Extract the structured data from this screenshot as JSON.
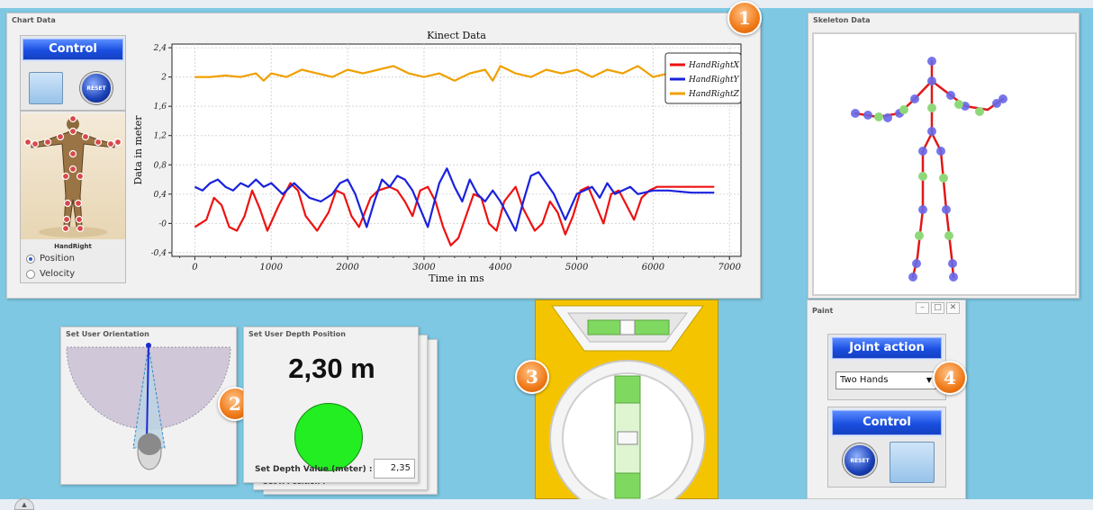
{
  "chart_panel": {
    "title": "Chart Data",
    "control_label": "Control",
    "reset_label": "RESET",
    "joint_label": "HandRight",
    "radio_position": "Position",
    "radio_velocity": "Velocity",
    "badge": "1"
  },
  "chart_data": {
    "type": "line",
    "title": "Kinect Data",
    "xlabel": "Time in ms",
    "ylabel": "Data in meter",
    "xlim": [
      -300,
      7150
    ],
    "ylim": [
      -0.45,
      2.45
    ],
    "x_ticks": [
      "0",
      "1000",
      "2000",
      "3000",
      "4000",
      "5000",
      "6000",
      "7000"
    ],
    "y_ticks": [
      "-0,4",
      "-0",
      "0,4",
      "0,8",
      "1,2",
      "1,6",
      "2",
      "2,4"
    ],
    "x_tick_values": [
      0,
      1000,
      2000,
      3000,
      4000,
      5000,
      6000,
      7000
    ],
    "y_tick_values": [
      -0.4,
      0,
      0.4,
      0.8,
      1.2,
      1.6,
      2.0,
      2.4
    ],
    "grid": true,
    "legend_position": "top-right",
    "series": [
      {
        "name": "HandRightX",
        "color": "#ee1111",
        "x": [
          0,
          150,
          250,
          350,
          450,
          550,
          650,
          750,
          850,
          950,
          1100,
          1250,
          1350,
          1450,
          1600,
          1750,
          1850,
          1950,
          2050,
          2150,
          2300,
          2400,
          2550,
          2650,
          2750,
          2850,
          2950,
          3050,
          3150,
          3250,
          3350,
          3450,
          3550,
          3650,
          3750,
          3850,
          3950,
          4050,
          4200,
          4300,
          4450,
          4550,
          4650,
          4750,
          4850,
          4950,
          5050,
          5150,
          5250,
          5350,
          5450,
          5550,
          5650,
          5750,
          5850,
          5950,
          6050,
          6200,
          6400,
          6600,
          6800
        ],
        "y": [
          -0.05,
          0.05,
          0.35,
          0.25,
          -0.05,
          -0.1,
          0.1,
          0.45,
          0.2,
          -0.1,
          0.25,
          0.55,
          0.45,
          0.1,
          -0.1,
          0.15,
          0.45,
          0.4,
          0.1,
          -0.05,
          0.35,
          0.45,
          0.5,
          0.45,
          0.3,
          0.1,
          0.45,
          0.5,
          0.3,
          -0.05,
          -0.3,
          -0.2,
          0.1,
          0.4,
          0.35,
          0.0,
          -0.1,
          0.3,
          0.5,
          0.2,
          -0.1,
          0.0,
          0.3,
          0.15,
          -0.15,
          0.1,
          0.45,
          0.5,
          0.25,
          0.0,
          0.4,
          0.45,
          0.25,
          0.05,
          0.35,
          0.45,
          0.5,
          0.5,
          0.5,
          0.5,
          0.5
        ]
      },
      {
        "name": "HandRightY",
        "color": "#1a22dd",
        "x": [
          0,
          100,
          200,
          300,
          400,
          500,
          600,
          700,
          800,
          900,
          1000,
          1150,
          1300,
          1400,
          1500,
          1650,
          1800,
          1900,
          2000,
          2100,
          2250,
          2350,
          2450,
          2550,
          2650,
          2750,
          2850,
          2950,
          3050,
          3200,
          3300,
          3400,
          3500,
          3600,
          3700,
          3800,
          3900,
          4000,
          4100,
          4200,
          4300,
          4400,
          4500,
          4600,
          4700,
          4850,
          5000,
          5100,
          5200,
          5300,
          5400,
          5500,
          5600,
          5700,
          5800,
          6000,
          6200,
          6500,
          6800
        ],
        "y": [
          0.5,
          0.45,
          0.55,
          0.6,
          0.5,
          0.45,
          0.55,
          0.5,
          0.6,
          0.5,
          0.55,
          0.4,
          0.55,
          0.45,
          0.35,
          0.3,
          0.4,
          0.55,
          0.6,
          0.4,
          -0.05,
          0.3,
          0.6,
          0.5,
          0.65,
          0.6,
          0.45,
          0.2,
          -0.05,
          0.55,
          0.75,
          0.5,
          0.3,
          0.6,
          0.4,
          0.3,
          0.45,
          0.3,
          0.1,
          -0.1,
          0.3,
          0.65,
          0.7,
          0.55,
          0.4,
          0.05,
          0.4,
          0.45,
          0.5,
          0.35,
          0.55,
          0.4,
          0.45,
          0.5,
          0.4,
          0.45,
          0.45,
          0.42,
          0.42
        ]
      },
      {
        "name": "HandRightZ",
        "color": "#f0a000",
        "x": [
          0,
          200,
          400,
          600,
          800,
          900,
          1000,
          1200,
          1400,
          1600,
          1800,
          2000,
          2200,
          2400,
          2600,
          2800,
          3000,
          3200,
          3400,
          3600,
          3800,
          3900,
          4000,
          4200,
          4400,
          4600,
          4800,
          5000,
          5200,
          5400,
          5600,
          5800,
          6000,
          6200,
          6400,
          6600,
          6800
        ],
        "y": [
          2.0,
          2.0,
          2.02,
          2.0,
          2.05,
          1.95,
          2.05,
          2.0,
          2.1,
          2.05,
          2.0,
          2.1,
          2.05,
          2.1,
          2.15,
          2.05,
          2.0,
          2.05,
          1.95,
          2.05,
          2.1,
          1.95,
          2.15,
          2.05,
          2.0,
          2.1,
          2.05,
          2.1,
          2.0,
          2.1,
          2.05,
          2.15,
          2.0,
          2.05,
          2.0,
          2.02,
          2.0
        ]
      }
    ]
  },
  "skeleton_panel": {
    "title": "Skeleton Data"
  },
  "orientation_panel": {
    "title": "Set User Orientation",
    "badge": "2"
  },
  "depth_panel": {
    "title": "Set User Depth Position",
    "value": "2,30 m",
    "input_label": "Set Depth Value (meter) :",
    "input_value": "2,35",
    "behind_label": "Set X Position :"
  },
  "level_panel": {
    "badge": "3"
  },
  "paint_panel": {
    "title": "Paint",
    "joint_action_label": "Joint action",
    "dropdown_value": "Two Hands",
    "control_label": "Control",
    "reset_label": "RESET",
    "badge": "4"
  },
  "colors": {
    "background": "#7ec8e3",
    "accent_blue": "#1a4fe0",
    "badge_orange": "#f07a18",
    "depth_green": "#22ee22",
    "level_yellow": "#f5c400"
  }
}
